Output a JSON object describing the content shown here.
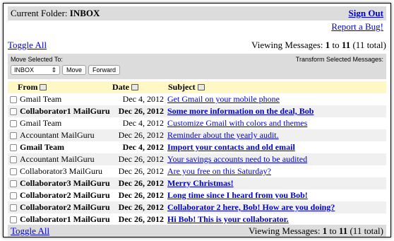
{
  "header": {
    "folder_prefix": "Current Folder:",
    "folder_name": "INBOX",
    "sign_out": "Sign Out",
    "report_bug": "Report a Bug!"
  },
  "toolbar": {
    "toggle_all": "Toggle All",
    "viewing_prefix": "Viewing Messages:",
    "range_start": "1",
    "range_to": "to",
    "range_end": "11",
    "total": "(11 total)"
  },
  "controls": {
    "move_label": "Move Selected To:",
    "transform_label": "Transform Selected Messages:",
    "folder_select": "INBOX",
    "move_button": "Move",
    "forward_button": "Forward"
  },
  "columns": {
    "from": "From",
    "date": "Date",
    "subject": "Subject"
  },
  "messages": [
    {
      "from": "Gmail Team",
      "date": "Dec 4, 2012",
      "subject": "Get Gmail on your mobile phone",
      "unread": false
    },
    {
      "from": "Collaborator1 MailGuru",
      "date": "Dec 26, 2012",
      "subject": "Some more information on the deal, Bob",
      "unread": true
    },
    {
      "from": "Gmail Team",
      "date": "Dec 4, 2012",
      "subject": "Customize Gmail with colors and themes",
      "unread": false
    },
    {
      "from": "Accountant MailGuru",
      "date": "Dec 26, 2012",
      "subject": "Reminder about the yearly audit.",
      "unread": false
    },
    {
      "from": "Gmail Team",
      "date": "Dec 4, 2012",
      "subject": "Import your contacts and old email",
      "unread": true
    },
    {
      "from": "Accountant MailGuru",
      "date": "Dec 26, 2012",
      "subject": "Your savings accounts need to be audited",
      "unread": false
    },
    {
      "from": "Collaborator3 MailGuru",
      "date": "Dec 26, 2012",
      "subject": "Are you free on this Saturday?",
      "unread": false
    },
    {
      "from": "Collaborator3 MailGuru",
      "date": "Dec 26, 2012",
      "subject": "Merry Christmas!",
      "unread": true
    },
    {
      "from": "Collaborator2 MailGuru",
      "date": "Dec 26, 2012",
      "subject": "Long time since I heard from you Bob!",
      "unread": true
    },
    {
      "from": "Collaborator2 MailGuru",
      "date": "Dec 26, 2012",
      "subject": "Collaborator 2 here, Bob! How are you doing?",
      "unread": true
    },
    {
      "from": "Collaborator1 MailGuru",
      "date": "Dec 26, 2012",
      "subject": "Hi Bob! This is your collaborator.",
      "unread": true
    }
  ],
  "footer": {
    "toggle_all": "Toggle All",
    "viewing_prefix": "Viewing Messages:",
    "range_start": "1",
    "range_to": "to",
    "range_end": "11",
    "total": "(11 total)"
  }
}
